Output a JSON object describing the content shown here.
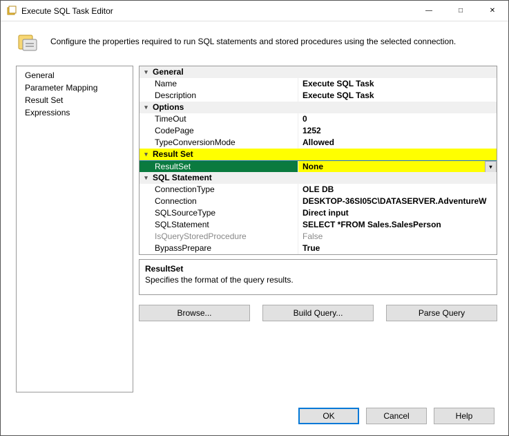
{
  "window": {
    "title": "Execute SQL Task Editor",
    "description": "Configure the properties required to run SQL statements and stored procedures using the selected connection."
  },
  "nav": {
    "items": [
      "General",
      "Parameter Mapping",
      "Result Set",
      "Expressions"
    ]
  },
  "propgrid": {
    "categories": [
      {
        "label": "General",
        "highlight": false,
        "rows": [
          {
            "name": "Name",
            "value": "Execute SQL Task"
          },
          {
            "name": "Description",
            "value": "Execute SQL Task"
          }
        ]
      },
      {
        "label": "Options",
        "highlight": false,
        "rows": [
          {
            "name": "TimeOut",
            "value": "0"
          },
          {
            "name": "CodePage",
            "value": "1252"
          },
          {
            "name": "TypeConversionMode",
            "value": "Allowed"
          }
        ]
      },
      {
        "label": "Result Set",
        "highlight": true,
        "rows": [
          {
            "name": "ResultSet",
            "value": "None",
            "selected": true,
            "dropdown": true
          }
        ]
      },
      {
        "label": "SQL Statement",
        "highlight": false,
        "rows": [
          {
            "name": "ConnectionType",
            "value": "OLE DB"
          },
          {
            "name": "Connection",
            "value": "DESKTOP-36SI05C\\DATASERVER.AdventureW"
          },
          {
            "name": "SQLSourceType",
            "value": "Direct input"
          },
          {
            "name": "SQLStatement",
            "value": "SELECT    *FROM         Sales.SalesPerson"
          },
          {
            "name": "IsQueryStoredProcedure",
            "value": "False",
            "disabled": true
          },
          {
            "name": "BypassPrepare",
            "value": "True"
          }
        ]
      }
    ]
  },
  "help": {
    "title": "ResultSet",
    "text": "Specifies the format of the query results."
  },
  "actions": {
    "browse": "Browse...",
    "build": "Build Query...",
    "parse": "Parse Query"
  },
  "footer": {
    "ok": "OK",
    "cancel": "Cancel",
    "help": "Help"
  }
}
